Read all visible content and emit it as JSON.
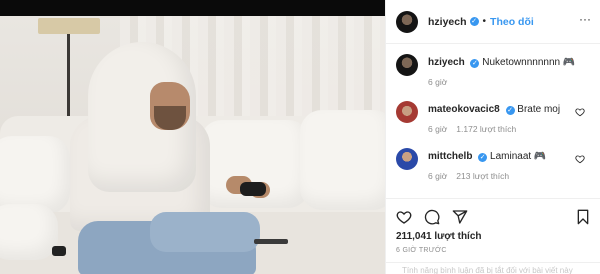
{
  "header": {
    "username": "hziyech",
    "verified_glyph": "✓",
    "separator": "•",
    "follow_label": "Theo dõi",
    "more_glyph": "···"
  },
  "caption": {
    "username": "hziyech",
    "text": "Nuketownnnnnnn 🎮",
    "time": "6 giờ"
  },
  "comments": [
    {
      "username": "mateokovacic8",
      "text": "Brate moj",
      "time": "6 giờ",
      "likes": "1.172 lượt thích",
      "avatar": "avatar-mateokovacic8"
    },
    {
      "username": "mittchelb",
      "text": "Laminaat 🎮",
      "time": "6 giờ",
      "likes": "213 lượt thích",
      "avatar": "avatar-mittchelb"
    }
  ],
  "actions": {
    "icons": [
      "heart-icon",
      "comment-icon",
      "share-icon",
      "bookmark-icon"
    ],
    "likes": "211,041 lượt thích",
    "posted": "6 GIỜ TRƯỚC"
  },
  "comment_box": {
    "placeholder_text": "Tính năng bình luận đã bị tắt đối với bài viết này"
  },
  "colors": {
    "accent": "#3897f0",
    "text": "#262626",
    "muted": "#8e8e8e",
    "divider": "#efefef"
  }
}
